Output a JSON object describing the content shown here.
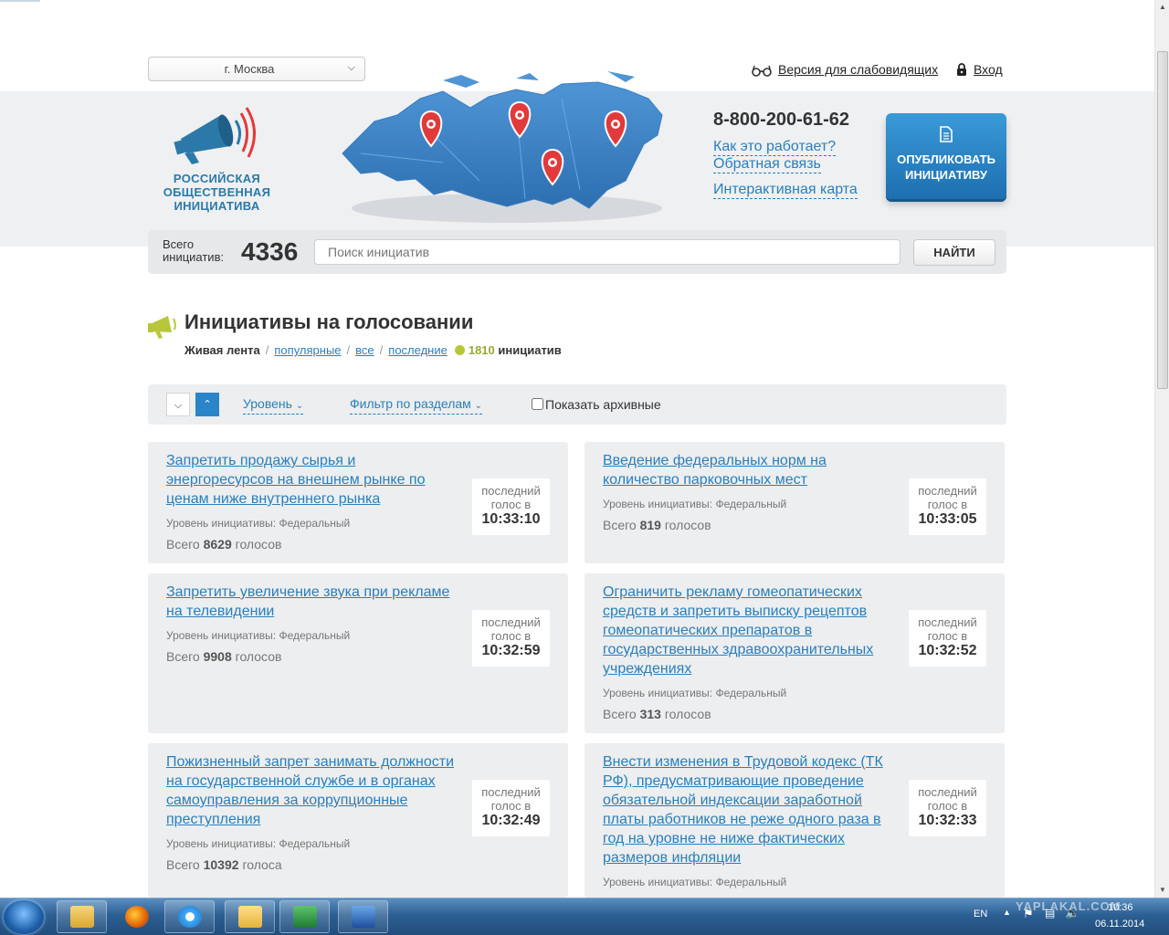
{
  "header": {
    "city": "г. Москва",
    "accessibility_label": "Версия для слабовидящих",
    "login_label": "Вход",
    "logo_lines": [
      "РОССИЙСКАЯ",
      "ОБЩЕСТВЕННАЯ",
      "ИНИЦИАТИВА"
    ],
    "phone": "8-800-200-61-62",
    "links": {
      "how_it_works": "Как это работает?",
      "feedback": "Обратная связь",
      "interactive_map": "Интерактивная карта"
    },
    "publish_button": [
      "ОПУБЛИКОВАТЬ",
      "ИНИЦИАТИВУ"
    ]
  },
  "search": {
    "total_label": [
      "Всего",
      "инициатив:"
    ],
    "total_count": "4336",
    "placeholder": "Поиск инициатив",
    "button": "НАЙТИ"
  },
  "section": {
    "title": "Инициативы на голосовании",
    "live_feed": "Живая лента",
    "tabs": [
      "популярные",
      "все",
      "последние"
    ],
    "count": "1810",
    "count_suffix": "инициатив"
  },
  "filters": {
    "level": "Уровень",
    "by_section": "Фильтр по разделам",
    "show_archived": "Показать архивные"
  },
  "card_labels": {
    "last_vote_line1": "последний",
    "last_vote_line2": "голос в"
  },
  "cards": [
    {
      "title": "Запретить продажу сырья и энергоресурсов на внешнем рынке по ценам ниже внутреннего рынка",
      "level": "Уровень инициативы: Федеральный",
      "votes_prefix": "Всего",
      "votes": "8629",
      "votes_suffix": "голосов",
      "time": "10:33:10"
    },
    {
      "title": "Введение федеральных норм на количество парковочных мест",
      "level": "Уровень инициативы: Федеральный",
      "votes_prefix": "Всего",
      "votes": "819",
      "votes_suffix": "голосов",
      "time": "10:33:05"
    },
    {
      "title": "Запретить увеличение звука при рекламе на телевидении",
      "level": "Уровень инициативы: Федеральный",
      "votes_prefix": "Всего",
      "votes": "9908",
      "votes_suffix": "голосов",
      "time": "10:32:59"
    },
    {
      "title": "Ограничить рекламу гомеопатических средств и запретить выписку рецептов гомеопатических препаратов в государственных здравоохранительных учреждениях",
      "level": "Уровень инициативы: Федеральный",
      "votes_prefix": "Всего",
      "votes": "313",
      "votes_suffix": "голосов",
      "time": "10:32:52"
    },
    {
      "title": "Пожизненный запрет занимать должности на государственной службе и в органах самоуправления за коррупционные преступления",
      "level": "Уровень инициативы: Федеральный",
      "votes_prefix": "Всего",
      "votes": "10392",
      "votes_suffix": "голоса",
      "time": "10:32:49"
    },
    {
      "title": "Внести изменения в Трудовой кодекс (ТК РФ), предусматривающие проведение обязательной индексации заработной платы работников не реже одного раза в год на уровне не ниже фактических размеров инфляции",
      "level": "Уровень инициативы: Федеральный",
      "votes_prefix": "",
      "votes": "",
      "votes_suffix": "",
      "time": "10:32:33"
    }
  ],
  "taskbar": {
    "lang": "EN",
    "time": "10:36",
    "date": "06.11.2014",
    "watermark": "YAPLAKAL.COM",
    "apps": [
      "explorer-icon",
      "firefox-icon",
      "ie-icon",
      "outlook-icon",
      "excel-icon",
      "word-icon"
    ]
  },
  "colors": {
    "link": "#2a7fba",
    "publish": "#2a85c8",
    "count_green": "#9aa832",
    "band": "#eef0f2"
  }
}
